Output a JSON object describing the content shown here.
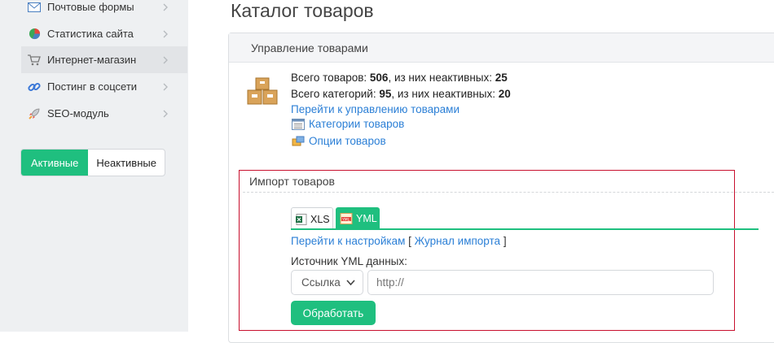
{
  "sidebar": {
    "items": [
      {
        "label": "Почтовые формы",
        "icon": "envelope-icon"
      },
      {
        "label": "Статистика сайта",
        "icon": "pie-chart-icon"
      },
      {
        "label": "Интернет-магазин",
        "icon": "cart-icon"
      },
      {
        "label": "Постинг в соцсети",
        "icon": "chain-link-icon"
      },
      {
        "label": "SEO-модуль",
        "icon": "rocket-icon"
      }
    ],
    "toggle": {
      "active": "Активные",
      "inactive": "Неактивные"
    }
  },
  "page": {
    "title": "Каталог товаров"
  },
  "manage": {
    "header": "Управление товарами",
    "products_prefix": "Всего товаров: ",
    "products_total": "506",
    "products_middle": ", из них неактивных: ",
    "products_inactive": "25",
    "categories_prefix": "Всего категорий: ",
    "categories_total": "95",
    "categories_middle": ", из них неактивных: ",
    "categories_inactive": "20",
    "manage_link": "Перейти к управлению товарами",
    "categories_link": "Категории товаров",
    "options_link": "Опции товаров"
  },
  "import": {
    "title": "Импорт товаров",
    "tabs": [
      {
        "label": "XLS"
      },
      {
        "label": "YML"
      }
    ],
    "settings_link": "Перейти к настройкам",
    "bracket_open": "[",
    "journal_link": "Журнал импорта",
    "bracket_close": "]",
    "source_label": "Источник YML данных:",
    "source_select": "Ссылка",
    "url_placeholder": "http://",
    "submit": "Обработать"
  },
  "colors": {
    "accent": "#1fbf7f",
    "link": "#2b7fd6",
    "highlight_border": "#c8102e"
  }
}
